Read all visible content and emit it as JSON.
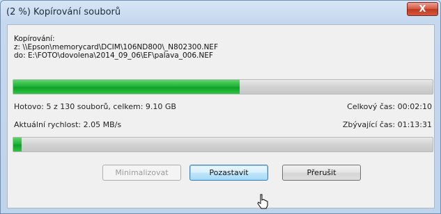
{
  "window": {
    "title": "(2 %) Kopírování souborů",
    "close_glyph": "X"
  },
  "copy": {
    "label": "Kopírování:",
    "from": "z: \\\\Epson\\memorycard\\DCIM\\106ND800\\_N802300.NEF",
    "to": "do: E:\\FOTO\\dovolena\\2014_09_06\\EF\\palava_006.NEF"
  },
  "progress": {
    "overall_fraction": 0.54,
    "file_fraction": 0.02
  },
  "stats": {
    "done": "Hotovo: 5 z 130 souborů, celkem: 9.10 GB",
    "total_time": "Celkový čas: 00:02:10",
    "speed": "Aktuální rychlost: 2.05 MB/s",
    "remaining": "Zbývající čas: 01:13:31"
  },
  "buttons": {
    "minimize": "Minimalizovat",
    "pause": "Pozastavit",
    "cancel": "Přerušit"
  },
  "colors": {
    "progress_green": "#22b43a",
    "titlebar": "#c6d8ee"
  }
}
